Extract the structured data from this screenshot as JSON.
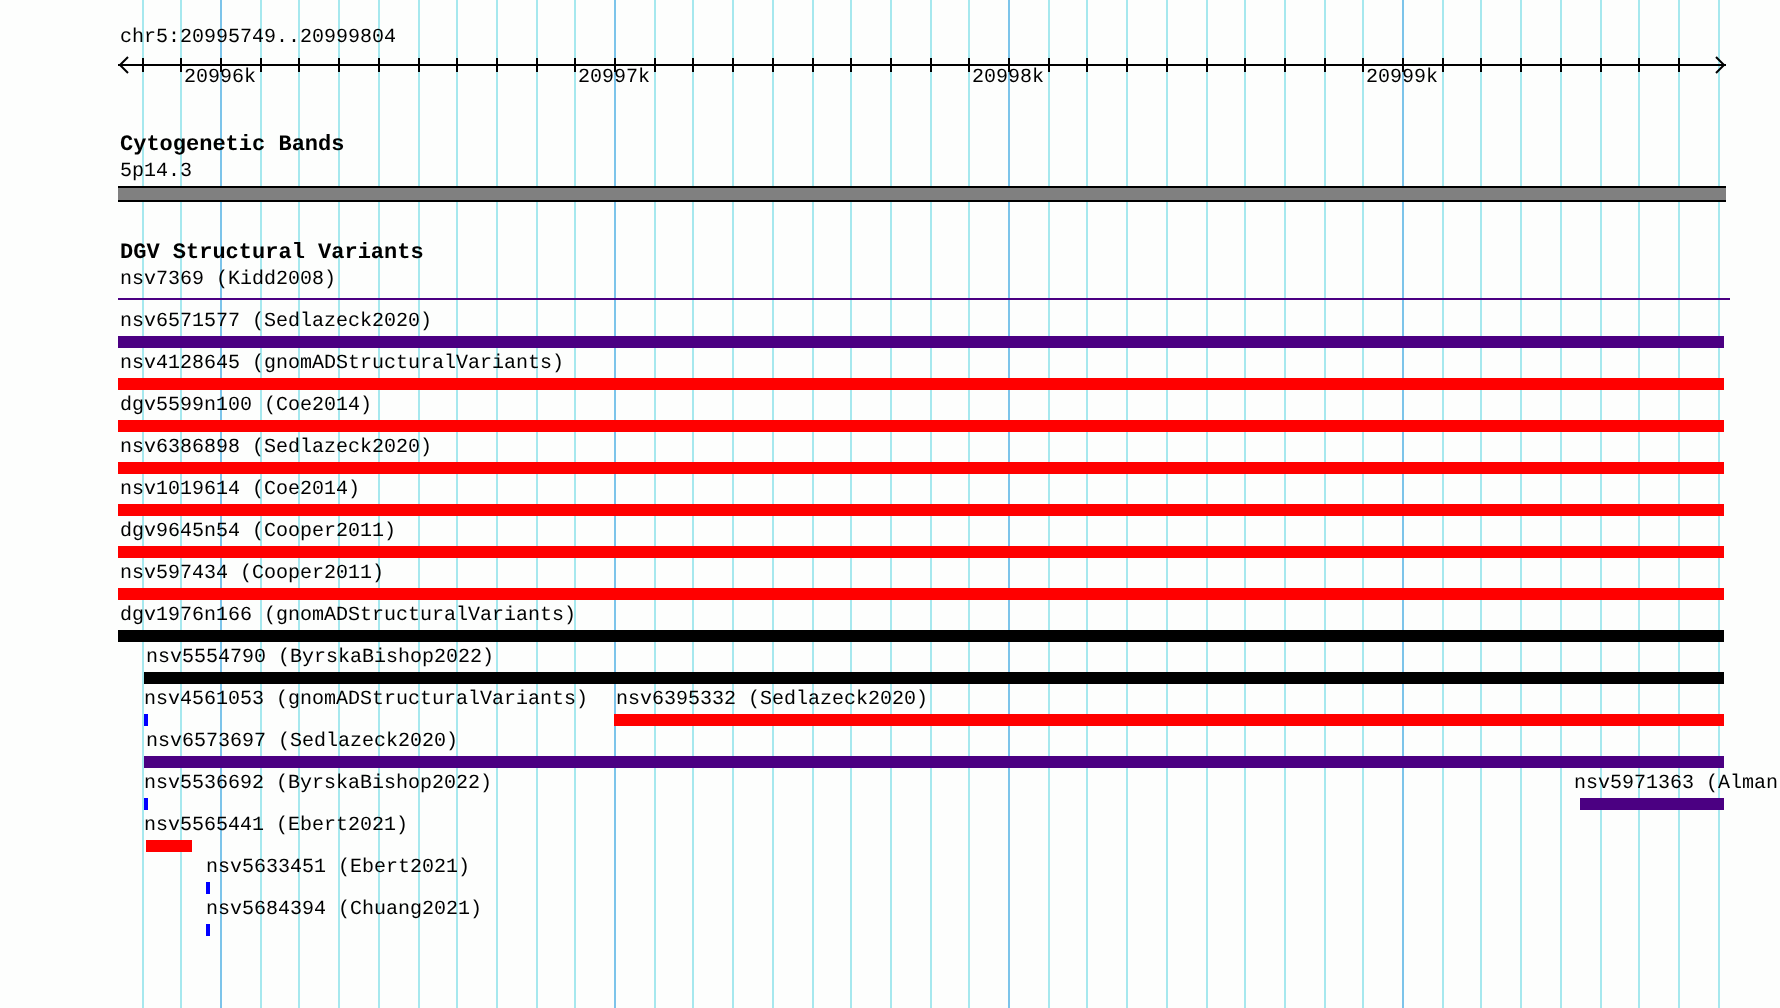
{
  "ruler": {
    "location": "chr5:20995749..20999804",
    "tick_labels": [
      "20996k",
      "20997k",
      "20998k",
      "20999k"
    ]
  },
  "tracks": [
    {
      "title": "Cytogenetic Bands",
      "kind": "band",
      "rows": [
        [
          {
            "label": "5p14.3",
            "color": "#808080"
          }
        ]
      ]
    },
    {
      "title": "DGV Structural Variants",
      "kind": "features",
      "rows": [
        [
          {
            "label": "nsv7369 (Kidd2008)",
            "color": "#4b0082",
            "kind": "line"
          }
        ],
        [
          {
            "label": "nsv6571577 (Sedlazeck2020)",
            "color": "#4b0082",
            "kind": "bar"
          }
        ],
        [
          {
            "label": "nsv4128645 (gnomADStructuralVariants)",
            "color": "#ff0000",
            "kind": "bar"
          }
        ],
        [
          {
            "label": "dgv5599n100 (Coe2014)",
            "color": "#ff0000",
            "kind": "bar"
          }
        ],
        [
          {
            "label": "nsv6386898 (Sedlazeck2020)",
            "color": "#ff0000",
            "kind": "bar"
          }
        ],
        [
          {
            "label": "nsv1019614 (Coe2014)",
            "color": "#ff0000",
            "kind": "bar"
          }
        ],
        [
          {
            "label": "dgv9645n54 (Cooper2011)",
            "color": "#ff0000",
            "kind": "bar"
          }
        ],
        [
          {
            "label": "nsv597434 (Cooper2011)",
            "color": "#ff0000",
            "kind": "bar"
          }
        ],
        [
          {
            "label": "dgv1976n166 (gnomADStructuralVariants)",
            "color": "#000000",
            "kind": "bar"
          }
        ],
        [
          {
            "label": "nsv5554790 (ByrskaBishop2022)",
            "color": "#000000",
            "kind": "bar"
          }
        ],
        [
          {
            "label": "nsv4561053 (gnomADStructuralVariants)",
            "color": "#0000ff",
            "kind": "bar"
          },
          {
            "label": "nsv6395332 (Sedlazeck2020)",
            "color": "#ff0000",
            "kind": "bar"
          }
        ],
        [
          {
            "label": "nsv6573697 (Sedlazeck2020)",
            "color": "#4b0082",
            "kind": "bar"
          }
        ],
        [
          {
            "label": "nsv5536692 (ByrskaBishop2022)",
            "color": "#0000ff",
            "kind": "bar"
          },
          {
            "label": "nsv5971363 (Alman",
            "color": "#4b0082",
            "kind": "bar"
          }
        ],
        [
          {
            "label": "nsv5565441 (Ebert2021)",
            "color": "#ff0000",
            "kind": "bar"
          }
        ],
        [
          {
            "label": "nsv5633451 (Ebert2021)",
            "color": "#0000ff",
            "kind": "bar"
          }
        ],
        [
          {
            "label": "nsv5684394 (Chuang2021)",
            "color": "#0000ff",
            "kind": "bar"
          }
        ]
      ]
    }
  ]
}
